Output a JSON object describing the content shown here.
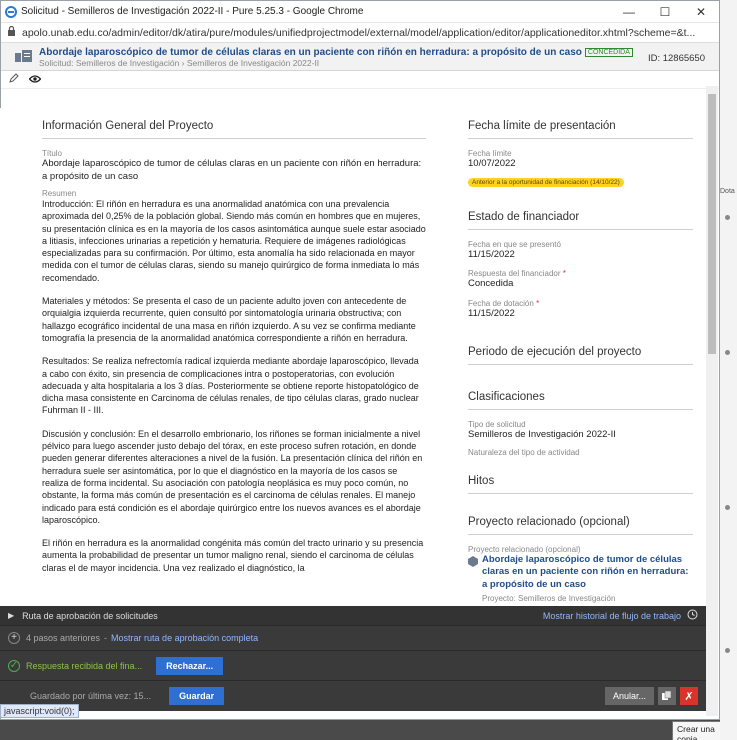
{
  "browser": {
    "title": "Solicitud - Semilleros de Investigación 2022-II - Pure 5.25.3 - Google Chrome",
    "url": "apolo.unab.edu.co/admin/editor/dk/atira/pure/modules/unifiedprojectmodel/external/model/application/editor/applicationeditor.xhtml?scheme=&t...",
    "status_link": "javascript:void(0);",
    "tooltip": "Crear una copia",
    "bg_text": "Dota"
  },
  "header": {
    "title": "Abordaje laparoscópico de tumor de células claras en un paciente con riñón en herradura: a propósito de un caso",
    "badge": "CONCEDIDA",
    "subtitle": "Solicitud: Semilleros de Investigación › Semilleros de Investigación 2022-II",
    "id": "ID: 12865650"
  },
  "left": {
    "section_title": "Información General del Proyecto",
    "title_label": "Título",
    "title_value": "Abordaje laparoscópico de tumor de células claras en un paciente con riñón en herradura: a propósito de un caso",
    "summary_label": "Resumen",
    "paragraphs": [
      "Introducción: El riñón en herradura es una anormalidad anatómica con una prevalencia aproximada del 0,25% de la población global. Siendo más común en hombres que en mujeres, su presentación clínica es en la mayoría de los casos asintomática aunque suele estar asociado a litiasis, infecciones urinarias a repetición y hematuria. Requiere de imágenes radiológicas especializadas para su confirmación. Por último, esta anomalía ha sido relacionada en mayor medida con el tumor de células claras, siendo su manejo quirúrgico de forma inmediata lo más recomendado.",
      "Materiales y métodos: Se presenta el caso de un paciente adulto joven con antecedente de orquialgia izquierda recurrente, quien consultó por sintomatología urinaria obstructiva; con hallazgo ecográfico incidental de una masa en riñón izquierdo. A su vez se confirma mediante tomografía la presencia de la anormalidad anatómica correspondiente a riñón en herradura.",
      "Resultados: Se realiza nefrectomía radical izquierda mediante abordaje laparoscópico, llevada a cabo con éxito, sin presencia de complicaciones intra o postoperatorias, con evolución adecuada y alta hospitalaria a los 3 días. Posteriormente se obtiene reporte histopatológico de dicha masa consistente en Carcinoma de células renales, de tipo células claras, grado nuclear Fuhrman II - III.",
      "Discusión y conclusión: En el desarrollo embrionario, los riñones se forman inicialmente a nivel pélvico para luego ascender justo debajo del tórax, en este proceso sufren rotación, en donde pueden generar diferentes alteraciones a nivel de la fusión. La presentación clínica del riñón en herradura suele ser asintomática, por lo que el diagnóstico en la mayoría de los casos se realiza de forma incidental. Su asociación con patología neoplásica es muy poco común, no obstante, la forma más común de presentación es el carcinoma de células renales. El manejo indicado para está condición es el abordaje quirúrgico entre los nuevos avances es el abordaje laparoscópico.",
      "El riñón en herradura es la anormalidad congénita más común del tracto urinario y su presencia aumenta la probabilidad de presentar un tumor maligno renal, siendo el carcinoma de células claras el de mayor incidencia. Una vez realizado el diagnóstico, la"
    ]
  },
  "right": {
    "deadline": {
      "section_title": "Fecha límite de presentación",
      "label": "Fecha límite",
      "value": "10/07/2022",
      "badge": "Anterior a la oportunidad de financiación (14/10/22)"
    },
    "funder": {
      "section_title": "Estado de financiador",
      "submitted_label": "Fecha en que se presentó",
      "submitted_value": "11/15/2022",
      "response_label": "Respuesta del financiador",
      "response_value": "Concedida",
      "award_label": "Fecha de dotación",
      "award_value": "11/15/2022",
      "required_mark": "*"
    },
    "period": {
      "section_title": "Periodo de ejecución del proyecto"
    },
    "classifications": {
      "section_title": "Clasificaciones",
      "type_label": "Tipo de solicitud",
      "type_value": "Semilleros de Investigación 2022-II",
      "nature_label": "Naturaleza del tipo de actividad"
    },
    "milestones": {
      "section_title": "Hitos"
    },
    "related": {
      "section_title": "Proyecto relacionado (opcional)",
      "label": "Proyecto relacionado (opcional)",
      "link": "Abordaje laparoscópico de tumor de células claras en un paciente con riñón en herradura: a propósito de un caso",
      "project": "Proyecto: Semilleros de Investigación"
    }
  },
  "workflow": {
    "route_label": "Ruta de aprobación de solicitudes",
    "history_link": "Mostrar historial de flujo de trabajo",
    "previous_steps": "4 pasos anteriores",
    "show_route": "Mostrar ruta de aprobación completa",
    "received": "Respuesta recibida del fina...",
    "reject": "Rechazar...",
    "last_saved": "Guardado por última vez: 15...",
    "save": "Guardar",
    "cancel": "Anular..."
  },
  "colors": {
    "accent_blue": "#2e6fd1",
    "link_blue": "#1f4d8a",
    "badge_yellow": "#ffd21f",
    "footer_bg": "#3a3a3a",
    "delete_red": "#d9342b"
  }
}
